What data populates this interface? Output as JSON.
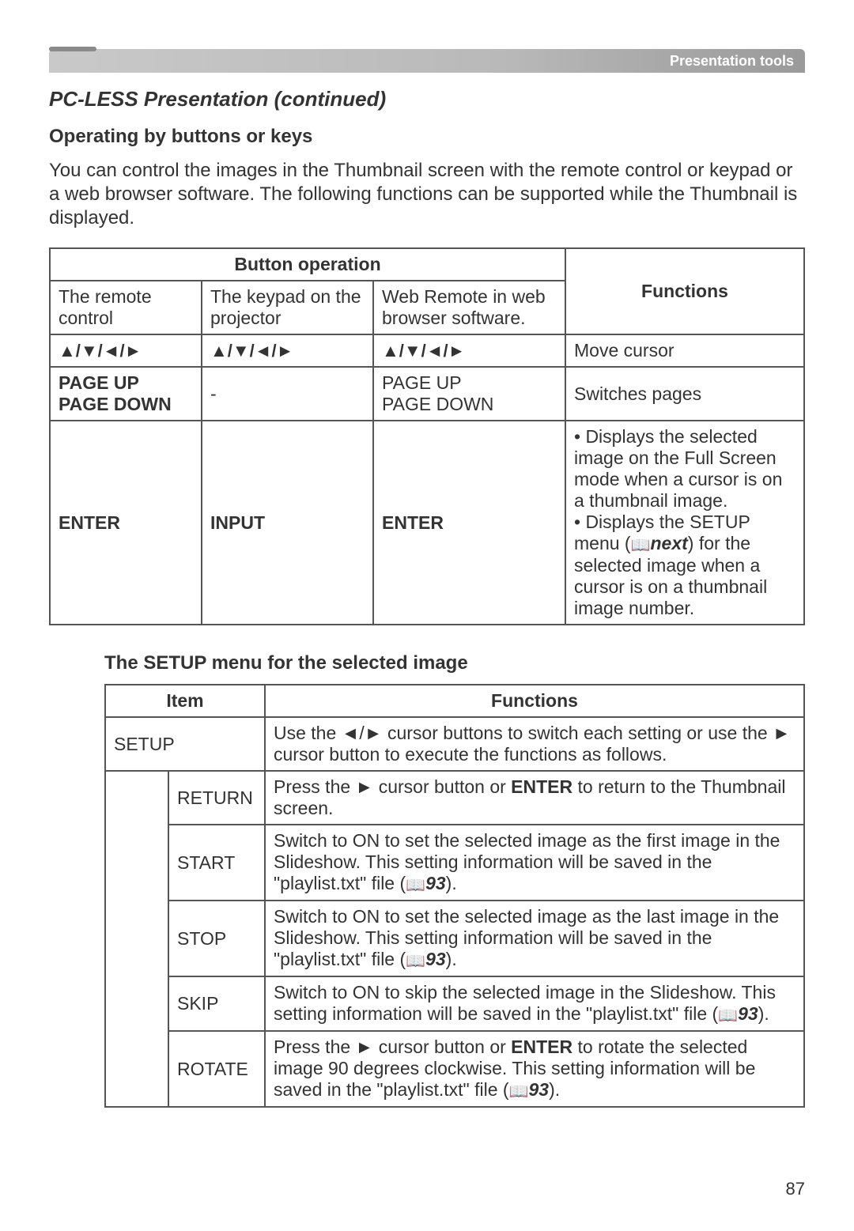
{
  "header": {
    "label": "Presentation tools"
  },
  "section_title": "PC-LESS Presentation (continued)",
  "subhead1": "Operating by buttons or keys",
  "intro_text": "You can control the images in the Thumbnail screen with the remote control or keypad or a web browser software. The following functions can be supported while the Thumbnail is displayed.",
  "table1": {
    "button_op_header": "Button operation",
    "functions_header": "Functions",
    "col_remote": "The remote control",
    "col_keypad": "The keypad on the projector",
    "col_web": "Web Remote in web browser software.",
    "arrows": "▲/▼/◄/►",
    "row1_func": "Move cursor",
    "row2_remote_l1": "PAGE UP",
    "row2_remote_l2": "PAGE DOWN",
    "row2_keypad": "-",
    "row2_web_l1": "PAGE UP",
    "row2_web_l2": "PAGE DOWN",
    "row2_func": "Switches pages",
    "row3_remote": "ENTER",
    "row3_keypad": "INPUT",
    "row3_web": "ENTER",
    "row3_func_prefix": "• Displays the selected image on the Full Screen mode when a cursor is on a thumbnail image.",
    "row3_func_part2a": "• Displays the SETUP menu (",
    "row3_func_ref": "next",
    "row3_func_part2b": ") for the selected image when a cursor is on a thumbnail image number."
  },
  "subhead2": "The SETUP menu for the selected image",
  "table2": {
    "item_header": "Item",
    "func_header": "Functions",
    "rows": [
      {
        "name": "SETUP",
        "desc_pre": "Use the ◄/► cursor buttons to switch each setting or use the ► cursor button to execute the functions as follows.",
        "ref": ""
      },
      {
        "name": "RETURN",
        "desc_pre": "Press the ► cursor button or ",
        "enter_bold": "ENTER",
        "desc_post": " to return to the Thumbnail screen.",
        "ref": ""
      },
      {
        "name": "START",
        "desc_pre": "Switch to ON to set the selected image as the first image in the Slideshow. This setting information will be saved in the \"playlist.txt\" file (",
        "ref": "93",
        "desc_post": ")."
      },
      {
        "name": "STOP",
        "desc_pre": "Switch to ON to set the selected image as the last image in the Slideshow. This setting information will be saved in the \"playlist.txt\" file (",
        "ref": "93",
        "desc_post": ")."
      },
      {
        "name": "SKIP",
        "desc_pre": "Switch to ON to skip the selected image in the Slideshow. This setting information will be saved in the \"playlist.txt\" file (",
        "ref": "93",
        "desc_post": ")."
      },
      {
        "name": "ROTATE",
        "desc_pre": "Press the ► cursor button or ",
        "enter_bold": "ENTER",
        "desc_post_a": " to rotate the selected image 90 degrees clockwise. This setting information will be saved in the \"playlist.txt\" file (",
        "ref": "93",
        "desc_post_b": ")."
      }
    ]
  },
  "page_number": "87"
}
